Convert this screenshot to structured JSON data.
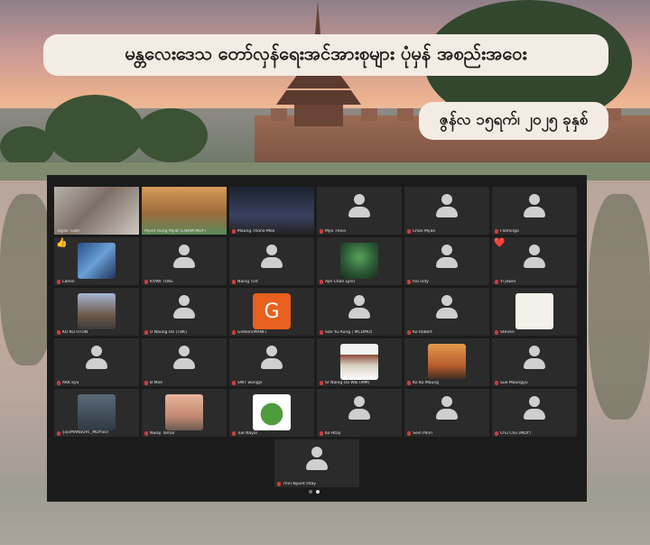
{
  "banner": {
    "title": "မန္တလေးဒေသ တော်လှန်ရေးအင်အားစုများ ပုံမှန် အစည်းအဝေး",
    "date": "ဇွန်လ ၁၅ရက်၊ ၂၀၂၅ ခုနှစ်"
  },
  "participants": [
    {
      "name": "Taylor Gale",
      "kind": "video",
      "muted": false
    },
    {
      "name": "Myint Aung Myat (CNAM-MDY)",
      "kind": "video",
      "muted": false,
      "active": true
    },
    {
      "name": "Maung Thone Moe",
      "kind": "video",
      "muted": true
    },
    {
      "name": "Myo Thein",
      "kind": "avatar",
      "muted": true
    },
    {
      "name": "Chan Myae",
      "kind": "avatar",
      "muted": true
    },
    {
      "name": "Flamingo",
      "kind": "avatar",
      "muted": true
    },
    {
      "name": "Lamin",
      "kind": "image",
      "muted": true,
      "reaction": "👍"
    },
    {
      "name": "KYAW TOKE",
      "kind": "avatar",
      "muted": true
    },
    {
      "name": "Naing Tint",
      "kind": "avatar",
      "muted": true
    },
    {
      "name": "Aye Chan Lynn",
      "kind": "image",
      "muted": true
    },
    {
      "name": "hal indy",
      "kind": "avatar",
      "muted": true
    },
    {
      "name": "Yi jewel",
      "kind": "avatar",
      "muted": true,
      "reaction": "❤️"
    },
    {
      "name": "KO KO HTUN",
      "kind": "image",
      "muted": true
    },
    {
      "name": "U Naung Oo (TBK)",
      "kind": "avatar",
      "muted": true
    },
    {
      "name": "Gideon(MANF)",
      "kind": "letter",
      "letter": "G",
      "muted": true
    },
    {
      "name": "San Yu Aung ( MCDMO)",
      "kind": "avatar",
      "muted": true
    },
    {
      "name": "Ko Robert",
      "kind": "avatar",
      "muted": true
    },
    {
      "name": "Steven",
      "kind": "image",
      "muted": true
    },
    {
      "name": "AKK kyu",
      "kind": "avatar",
      "muted": true
    },
    {
      "name": "B Moe",
      "kind": "avatar",
      "muted": true
    },
    {
      "name": "SWT wongyi",
      "kind": "avatar",
      "muted": true
    },
    {
      "name": "Sr Naing Oo Wai (MM)",
      "kind": "image",
      "muted": true
    },
    {
      "name": "Ko Ko Maung",
      "kind": "image",
      "muted": true
    },
    {
      "name": "Sue Maungyu",
      "kind": "avatar",
      "muted": true
    },
    {
      "name": "ခိုးခိုး(MANSURT_MDYSU)",
      "kind": "image",
      "muted": true
    },
    {
      "name": "Nway Tamar",
      "kind": "image",
      "muted": true
    },
    {
      "name": "Tue Nayar",
      "kind": "image",
      "muted": true
    },
    {
      "name": "Ko Htay",
      "kind": "avatar",
      "muted": true
    },
    {
      "name": "Sein Pann",
      "kind": "avatar",
      "muted": true
    },
    {
      "name": "Chu Chu (MDY)",
      "kind": "avatar",
      "muted": true
    }
  ],
  "last_participant": {
    "name": "Thiri Nyunt Htay",
    "kind": "avatar",
    "muted": true
  },
  "pager": {
    "pages": 2,
    "current": 2
  }
}
